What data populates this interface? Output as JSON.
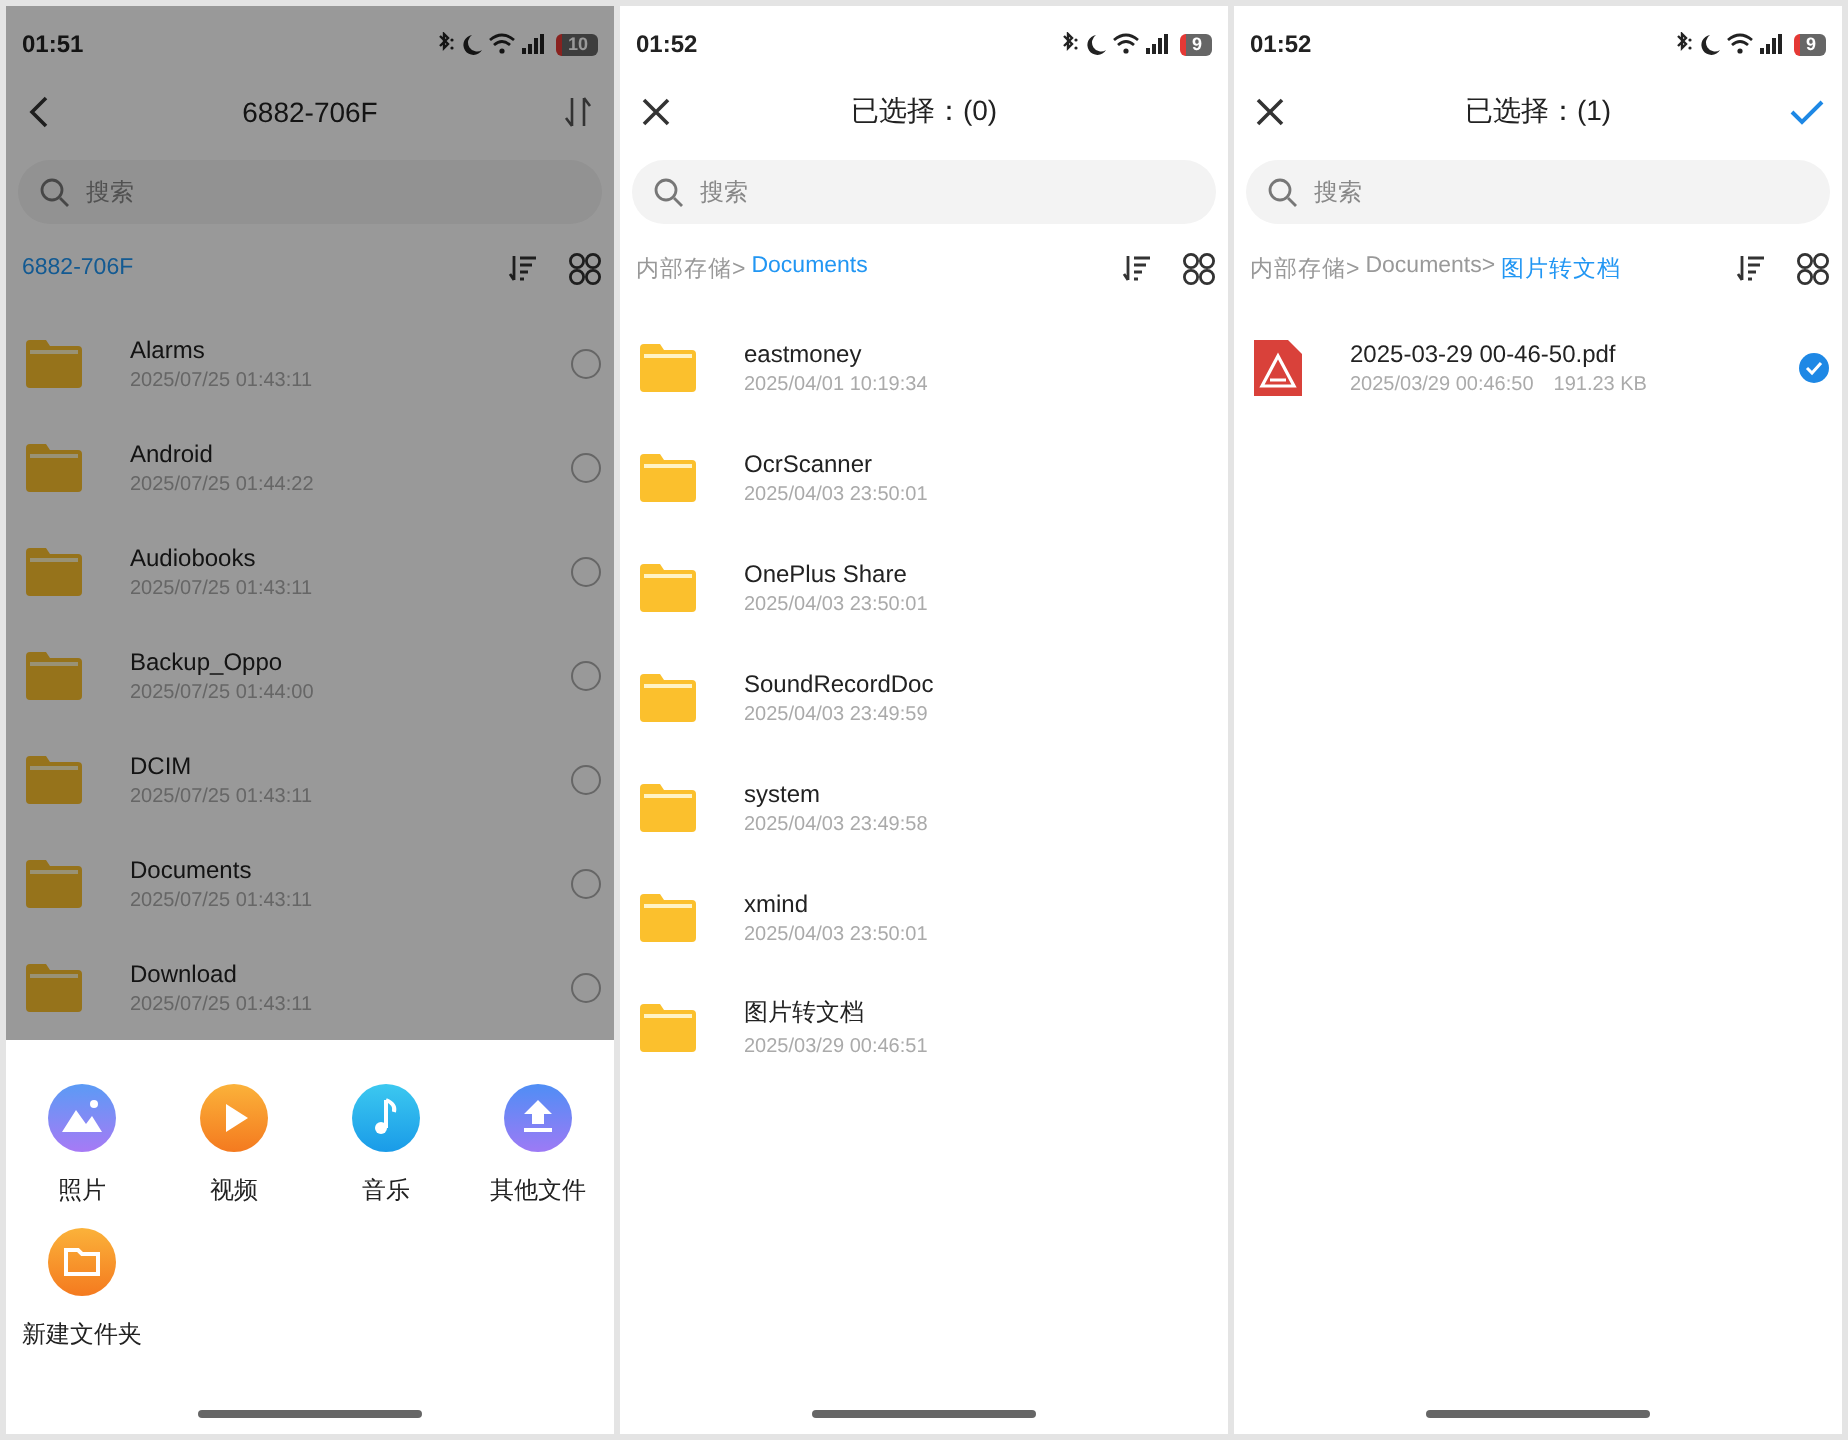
{
  "screens": [
    {
      "status_bar": {
        "time": "01:51",
        "battery": "10",
        "battery_low": true
      },
      "header": {
        "left_icon": {
          "kind": "back"
        },
        "title": "6882-706F",
        "right_icon": {
          "kind": "sort"
        }
      },
      "search": {
        "placeholder": "搜索"
      },
      "breadcrumb": [
        {
          "label": "6882-706F",
          "current": true
        }
      ],
      "dimmed": true,
      "items": [
        {
          "kind": "folder",
          "name": "Alarms",
          "meta": "2025/07/25 01:43:11",
          "selected": false
        },
        {
          "kind": "folder",
          "name": "Android",
          "meta": "2025/07/25 01:44:22",
          "selected": false
        },
        {
          "kind": "folder",
          "name": "Audiobooks",
          "meta": "2025/07/25 01:43:11",
          "selected": false
        },
        {
          "kind": "folder",
          "name": "Backup_Oppo",
          "meta": "2025/07/25 01:44:00",
          "selected": false
        },
        {
          "kind": "folder",
          "name": "DCIM",
          "meta": "2025/07/25 01:43:11",
          "selected": false
        },
        {
          "kind": "folder",
          "name": "Documents",
          "meta": "2025/07/25 01:43:11",
          "selected": false
        },
        {
          "kind": "folder",
          "name": "Download",
          "meta": "2025/07/25 01:43:11",
          "selected": false
        }
      ],
      "sheet": [
        {
          "kind": "photo",
          "label": "照片"
        },
        {
          "kind": "video",
          "label": "视频"
        },
        {
          "kind": "music",
          "label": "音乐"
        },
        {
          "kind": "upload",
          "label": "其他文件"
        },
        {
          "kind": "folder",
          "label": "新建文件夹"
        }
      ]
    },
    {
      "status_bar": {
        "time": "01:52",
        "battery": "9",
        "battery_low": true
      },
      "header": {
        "left_icon": {
          "kind": "close"
        },
        "title": "已选择：(0)"
      },
      "search": {
        "placeholder": "搜索"
      },
      "breadcrumb": [
        {
          "label": "内部存储>",
          "current": false
        },
        {
          "label": "Documents",
          "current": true
        }
      ],
      "items": [
        {
          "kind": "folder",
          "name": "eastmoney",
          "meta": "2025/04/01 10:19:34"
        },
        {
          "kind": "folder",
          "name": "OcrScanner",
          "meta": "2025/04/03 23:50:01"
        },
        {
          "kind": "folder",
          "name": "OnePlus Share",
          "meta": "2025/04/03 23:50:01"
        },
        {
          "kind": "folder",
          "name": "SoundRecordDoc",
          "meta": "2025/04/03 23:49:59"
        },
        {
          "kind": "folder",
          "name": "system",
          "meta": "2025/04/03 23:49:58"
        },
        {
          "kind": "folder",
          "name": "xmind",
          "meta": "2025/04/03 23:50:01"
        },
        {
          "kind": "folder",
          "name": "图片转文档",
          "meta": "2025/03/29 00:46:51"
        }
      ]
    },
    {
      "status_bar": {
        "time": "01:52",
        "battery": "9",
        "battery_low": true
      },
      "header": {
        "left_icon": {
          "kind": "close"
        },
        "title": "已选择：(1)",
        "right_icon": {
          "kind": "confirm"
        }
      },
      "search": {
        "placeholder": "搜索"
      },
      "breadcrumb": [
        {
          "label": "内部存储>",
          "current": false
        },
        {
          "label": "Documents>",
          "current": false
        },
        {
          "label": "图片转文档",
          "current": true
        }
      ],
      "items": [
        {
          "kind": "pdf",
          "name": "2025-03-29 00-46-50.pdf",
          "meta": "2025/03/29 00:46:50",
          "size": "191.23 KB",
          "selected": true
        }
      ]
    }
  ]
}
